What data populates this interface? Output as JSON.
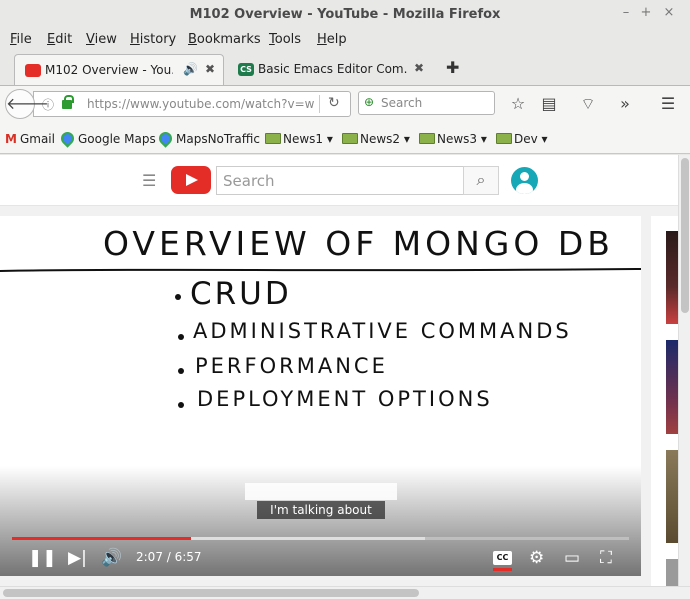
{
  "window": {
    "title": "M102 Overview - YouTube - Mozilla Firefox",
    "controls": [
      "–",
      "+",
      "×"
    ]
  },
  "menu": [
    "File",
    "Edit",
    "View",
    "History",
    "Bookmarks",
    "Tools",
    "Help"
  ],
  "menu_underline": [
    "F",
    "E",
    "V",
    "H",
    "B",
    "T",
    "H"
  ],
  "tabs": [
    {
      "label": "M102 Overview - You...",
      "audio_icon": "🔊",
      "close": "✖",
      "active": true
    },
    {
      "label": "Basic Emacs Editor Com...",
      "favicon_text": "CS",
      "close": "✖",
      "active": false
    }
  ],
  "new_tab": "✚",
  "navbar": {
    "url": "https://www.youtube.com/watch?v=w",
    "search_placeholder": "Search"
  },
  "bookmarks": [
    {
      "label": "Gmail",
      "icon": "gmail-icon"
    },
    {
      "label": "Google Maps",
      "icon": "maps-pin-icon"
    },
    {
      "label": "MapsNoTraffic",
      "icon": "maps-pin-icon"
    },
    {
      "label": "News1",
      "icon": "folder-icon"
    },
    {
      "label": "News2",
      "icon": "folder-icon"
    },
    {
      "label": "News3",
      "icon": "folder-icon"
    },
    {
      "label": "Dev",
      "icon": "folder-icon"
    }
  ],
  "youtube": {
    "search_placeholder": "Search",
    "time": "2:07 / 6:57",
    "progress_played": 0.29,
    "progress_loaded": 0.67,
    "cc_label": "CC",
    "caption_text": "I'm talking about"
  },
  "whiteboard": {
    "title": "OVERVIEW OF MONGO DB",
    "bullets": [
      "CRUD",
      "ADMINISTRATIVE COMMANDS",
      "PERFORMANCE",
      "DEPLOYMENT OPTIONS"
    ]
  },
  "colors": {
    "youtube_red": "#e52d27",
    "avatar": "#17a8b8",
    "lock_green": "#2e9b32"
  }
}
